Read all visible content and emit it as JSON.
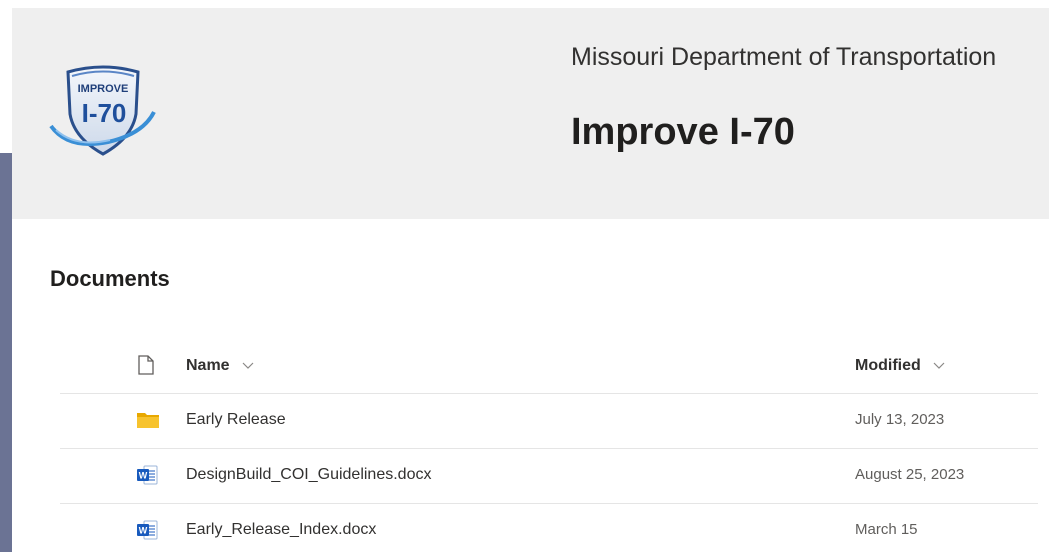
{
  "header": {
    "logo_text_top": "IMPROVE",
    "logo_text_main": "I-70",
    "org_name": "Missouri Department of Transportation",
    "site_title": "Improve I-70"
  },
  "documents": {
    "title": "Documents",
    "columns": {
      "name": "Name",
      "modified": "Modified"
    },
    "rows": [
      {
        "name": "Early Release",
        "modified": "July 13, 2023",
        "icon": "folder-icon"
      },
      {
        "name": "DesignBuild_COI_Guidelines.docx",
        "modified": "August 25, 2023",
        "icon": "word-doc-icon"
      },
      {
        "name": "Early_Release_Index.docx",
        "modified": "March 15",
        "icon": "word-doc-icon"
      }
    ]
  },
  "colors": {
    "header_bg": "#efefef",
    "side_rail": "#6b7394",
    "folder": "#f2b600",
    "word_blue": "#185abd"
  }
}
